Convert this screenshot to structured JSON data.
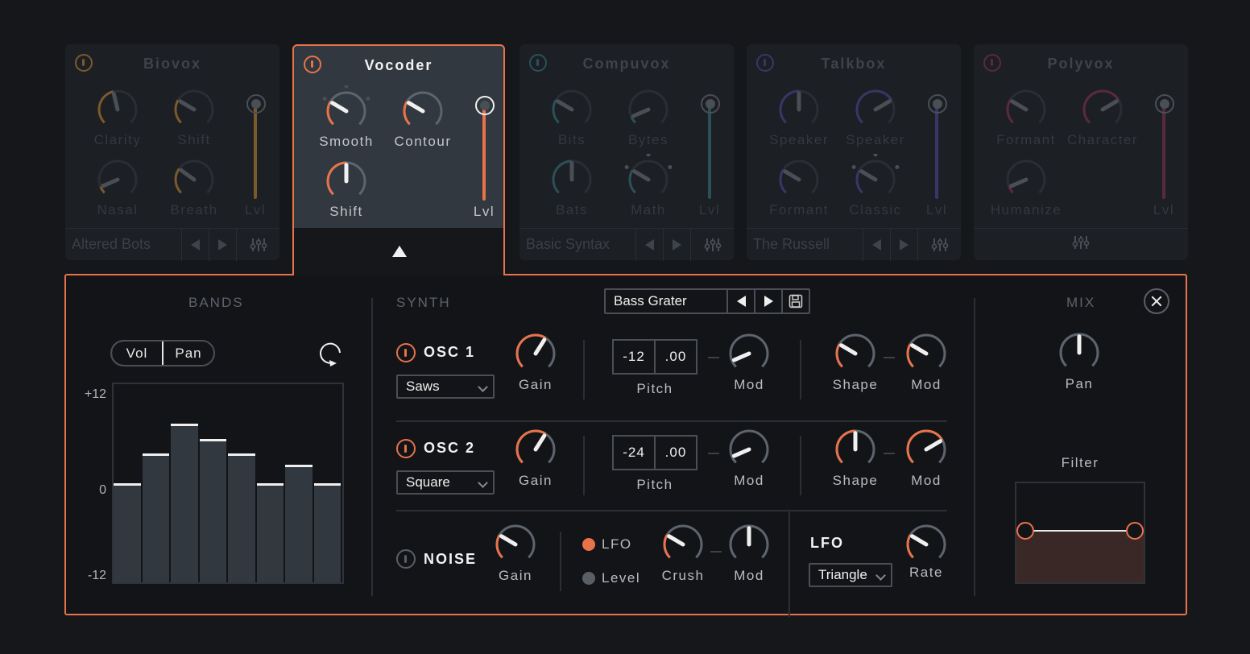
{
  "colors": {
    "accent": "#e8734a",
    "biovox": "#7a5a2a",
    "compuvox": "#2b5058",
    "talkbox": "#3a3568",
    "polyvox": "#5a2a3c"
  },
  "modules": [
    {
      "name": "Biovox",
      "active": false,
      "color": "#7a5a2a",
      "knobs": [
        {
          "label": "Clarity",
          "value": 0.45
        },
        {
          "label": "Shift",
          "value": 0.28
        },
        {
          "label": "Nasal",
          "value": 0.08
        },
        {
          "label": "Breath",
          "value": 0.3
        }
      ],
      "slider": {
        "label": "Lvl",
        "value": 1.0
      },
      "preset": "Altered Bots",
      "icons": [
        "prev-icon",
        "next-icon",
        "mixer-icon"
      ]
    },
    {
      "name": "Vocoder",
      "active": true,
      "color": "#e8734a",
      "knobs": [
        {
          "label": "Smooth",
          "value": 0.28
        },
        {
          "label": "Contour",
          "value": 0.28
        },
        {
          "label": "Shift",
          "value": 0.5
        }
      ],
      "slider": {
        "label": "Lvl",
        "value": 1.0
      },
      "preset": "",
      "icons": [
        "collapse-arrow-icon"
      ]
    },
    {
      "name": "Compuvox",
      "active": false,
      "color": "#2b5058",
      "knobs": [
        {
          "label": "Bits",
          "value": 0.28
        },
        {
          "label": "Bytes",
          "value": 0.08
        },
        {
          "label": "Bats",
          "value": 0.5
        },
        {
          "label": "Math",
          "value": 0.28
        }
      ],
      "slider": {
        "label": "Lvl",
        "value": 1.0
      },
      "preset": "Basic Syntax",
      "icons": [
        "prev-icon",
        "next-icon",
        "mixer-icon"
      ]
    },
    {
      "name": "Talkbox",
      "active": false,
      "color": "#3a3568",
      "knobs": [
        {
          "label": "Speaker",
          "value": 0.5
        },
        {
          "label": "Speaker",
          "value": 0.72
        },
        {
          "label": "Formant",
          "value": 0.28
        },
        {
          "label": "Classic",
          "value": 0.28
        }
      ],
      "slider": {
        "label": "Lvl",
        "value": 1.0
      },
      "preset": "The Russell",
      "icons": [
        "prev-icon",
        "next-icon",
        "mixer-icon"
      ]
    },
    {
      "name": "Polyvox",
      "active": false,
      "color": "#5a2a3c",
      "knobs": [
        {
          "label": "Formant",
          "value": 0.28
        },
        {
          "label": "Character",
          "value": 0.72
        },
        {
          "label": "Humanize",
          "value": 0.08
        }
      ],
      "slider": {
        "label": "Lvl",
        "value": 1.0
      },
      "preset": "",
      "icons": [
        "mixer-icon"
      ]
    }
  ],
  "editor": {
    "bands": {
      "title": "BANDS",
      "toggle": {
        "options": [
          "Vol",
          "Pan"
        ],
        "selected": "Vol"
      },
      "y_ticks": [
        "+12",
        "0",
        "-12"
      ],
      "ylim": [
        -12,
        12
      ],
      "values": [
        0,
        4,
        8,
        6,
        4,
        0,
        2.5,
        0
      ]
    },
    "synth": {
      "title": "SYNTH",
      "preset": "Bass Grater",
      "osc1": {
        "label": "OSC 1",
        "on": true,
        "waveform": "Saws",
        "gain": {
          "label": "Gain",
          "value": 0.62
        },
        "pitch": {
          "label": "Pitch",
          "semi": "-12",
          "fine": ".00"
        },
        "pitch_mod": {
          "label": "Mod",
          "value": 0.08
        },
        "shape": {
          "label": "Shape",
          "value": 0.28
        },
        "shape_mod": {
          "label": "Mod",
          "value": 0.28
        }
      },
      "osc2": {
        "label": "OSC 2",
        "on": true,
        "waveform": "Square",
        "gain": {
          "label": "Gain",
          "value": 0.62
        },
        "pitch": {
          "label": "Pitch",
          "semi": "-24",
          "fine": ".00"
        },
        "pitch_mod": {
          "label": "Mod",
          "value": 0.08
        },
        "shape": {
          "label": "Shape",
          "value": 0.5
        },
        "shape_mod": {
          "label": "Mod",
          "value": 0.72
        }
      },
      "noise": {
        "label": "NOISE",
        "on": false,
        "gain": {
          "label": "Gain",
          "value": 0.28
        },
        "mod_target": {
          "options": [
            "LFO",
            "Level"
          ],
          "selected": "LFO"
        },
        "crush": {
          "label": "Crush",
          "value": 0.28
        },
        "crush_mod": {
          "label": "Mod",
          "value": 0.5
        }
      },
      "lfo": {
        "label": "LFO",
        "waveform": "Triangle",
        "rate": {
          "label": "Rate",
          "value": 0.28
        }
      }
    },
    "mix": {
      "title": "MIX",
      "pan": {
        "label": "Pan",
        "value": 0.5
      },
      "filter": {
        "label": "Filter",
        "low": 0.0,
        "high": 1.0,
        "level": 0.5
      }
    }
  }
}
